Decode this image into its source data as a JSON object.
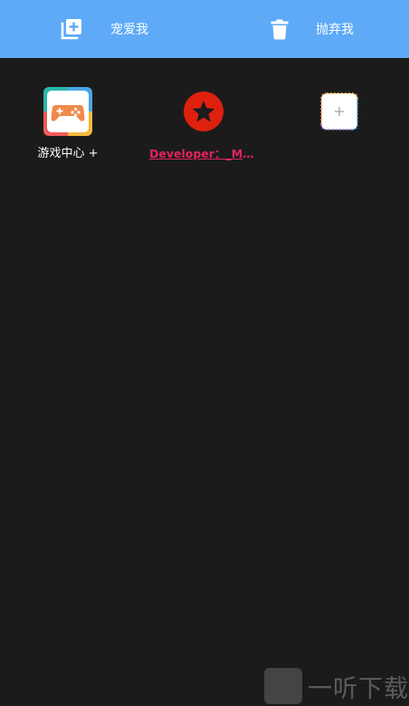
{
  "topbar": {
    "bg_color": "#5eaaf7",
    "favorite": {
      "label": "宠爱我",
      "icon": "add-to-library-icon"
    },
    "discard": {
      "label": "抛弃我",
      "icon": "trash-icon"
    }
  },
  "apps": [
    {
      "label": "游戏中心 +",
      "icon": "gamepad-icon"
    },
    {
      "label": "Developer：_Mr.Zhang",
      "icon": "star-badge-icon",
      "label_color": "#e0245e"
    },
    {
      "label": "",
      "icon": "add-slot-icon"
    }
  ],
  "watermark": {
    "badge_text": "听",
    "text": "一听下载"
  }
}
